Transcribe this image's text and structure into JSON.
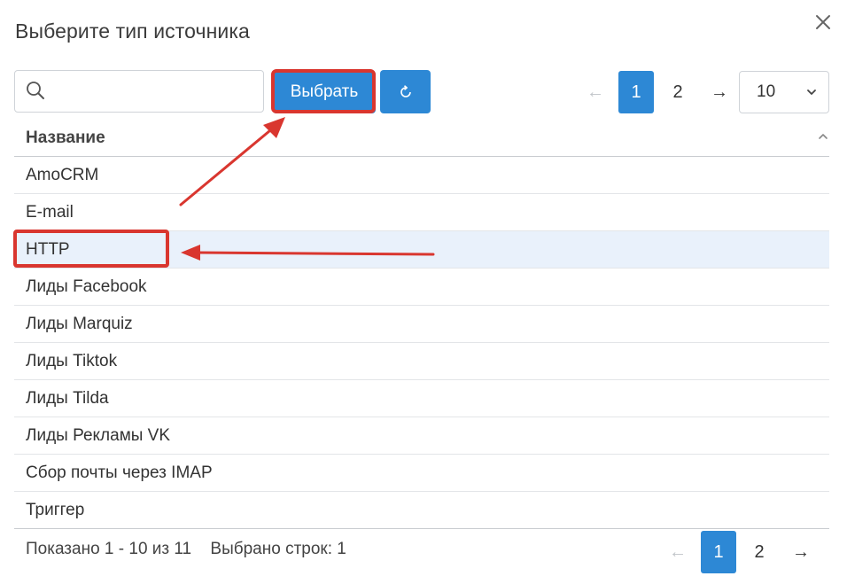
{
  "dialog": {
    "title": "Выберите тип источника",
    "close_icon": "close-icon"
  },
  "toolbar": {
    "search_value": "",
    "search_icon": "search-icon",
    "select_label": "Выбрать",
    "refresh_icon": "refresh-icon"
  },
  "pager_top": {
    "prev": "←",
    "pages": [
      "1",
      "2"
    ],
    "active_page": "1",
    "next": "→",
    "page_size": "10"
  },
  "table": {
    "header": "Название",
    "rows": [
      "AmoCRM",
      "E-mail",
      "HTTP",
      "Лиды Facebook",
      "Лиды Marquiz",
      "Лиды Tiktok",
      "Лиды Tilda",
      "Лиды Рекламы VK",
      "Сбор почты через IMAP",
      "Триггер"
    ],
    "selected_row": "HTTP"
  },
  "footer": {
    "shown": "Показано 1 - 10 из 11",
    "selected": "Выбрано строк: 1",
    "prev": "←",
    "pages": [
      "1",
      "2"
    ],
    "next": "→"
  },
  "colors": {
    "primary": "#2d88d5",
    "annotation": "#d9362f",
    "selected_row_bg": "#e9f1fb"
  }
}
